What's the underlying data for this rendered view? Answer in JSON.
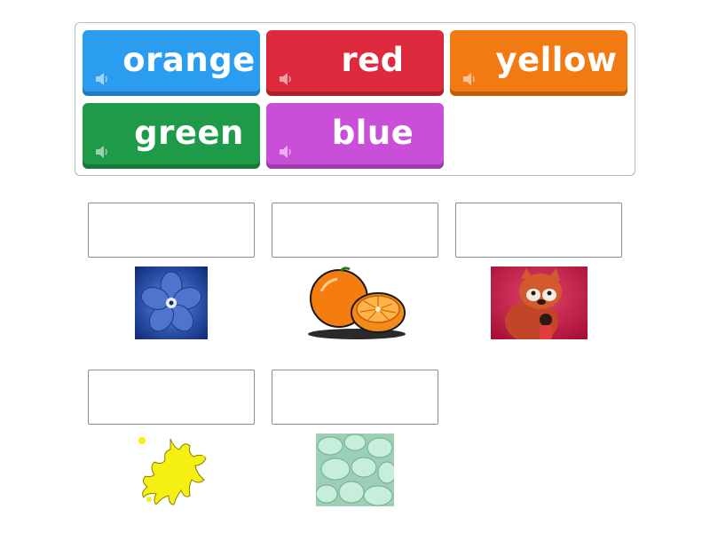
{
  "bank": {
    "tiles": [
      {
        "label": "orange",
        "color": "#2196f3"
      },
      {
        "label": "red",
        "color": "#e0283c"
      },
      {
        "label": "yellow",
        "color": "#f07a10"
      },
      {
        "label": "green",
        "color": "#1f9a47"
      },
      {
        "label": "blue",
        "color": "#c84bd8"
      }
    ],
    "speaker_icon": "speaker-icon"
  },
  "targets": [
    {
      "image": "blue-flower-image",
      "answer": ""
    },
    {
      "image": "oranges-image",
      "answer": ""
    },
    {
      "image": "red-panda-image",
      "answer": ""
    },
    {
      "image": "yellow-splat-image",
      "answer": ""
    },
    {
      "image": "green-sea-glass-image",
      "answer": ""
    }
  ]
}
